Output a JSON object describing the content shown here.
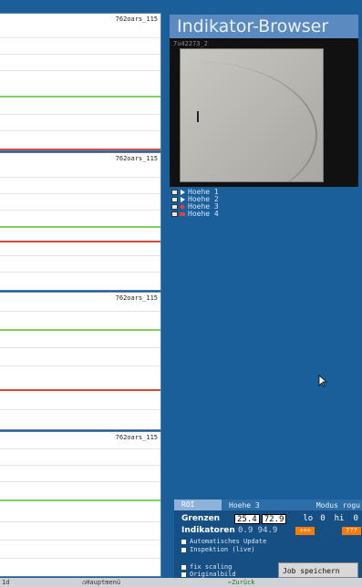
{
  "panels": [
    {
      "label": "762oars_115"
    },
    {
      "label": "762oars_115"
    },
    {
      "label": "762oars_115"
    },
    {
      "label": "762oars_115"
    }
  ],
  "colors": {
    "green_line": "#7ccf60",
    "red_line": "#d04a3a",
    "background": "#1a5f99"
  },
  "browser": {
    "title": "Indikator-Browser",
    "preview_id": "7u42273_2"
  },
  "indicators": [
    {
      "label": "Hoehe 1",
      "marker": "arrow-icon"
    },
    {
      "label": "Hoehe 2",
      "marker": "arrow-icon"
    },
    {
      "label": "Hoehe 3",
      "marker": "diamond-icon"
    },
    {
      "label": "Hoehe 4",
      "marker": "red-square-icon"
    }
  ],
  "roi": {
    "tab": "ROI",
    "hoehe": "Hoehe 3",
    "mode": "Modus rogu",
    "grenzen_label": "Grenzen",
    "grenzen_min": "25.4",
    "grenzen_max": "72.9",
    "lo_label": "lo",
    "lo_val": "0",
    "hi_label": "hi",
    "hi_val": "0",
    "indikatoren_label": "Indikatoren",
    "indikatoren_values": "0.9 94.9",
    "plus_label": "+++",
    "minus_label": "???",
    "auto_update": "Automatisches Update",
    "inspektion": "Inspektion (live)",
    "fix_scaling": "fix scaling",
    "originalbild": "Originalbild",
    "job_button": "Job speichern"
  },
  "status": {
    "left": "1d",
    "main": "Hauptmenü",
    "back": "Zurück"
  }
}
